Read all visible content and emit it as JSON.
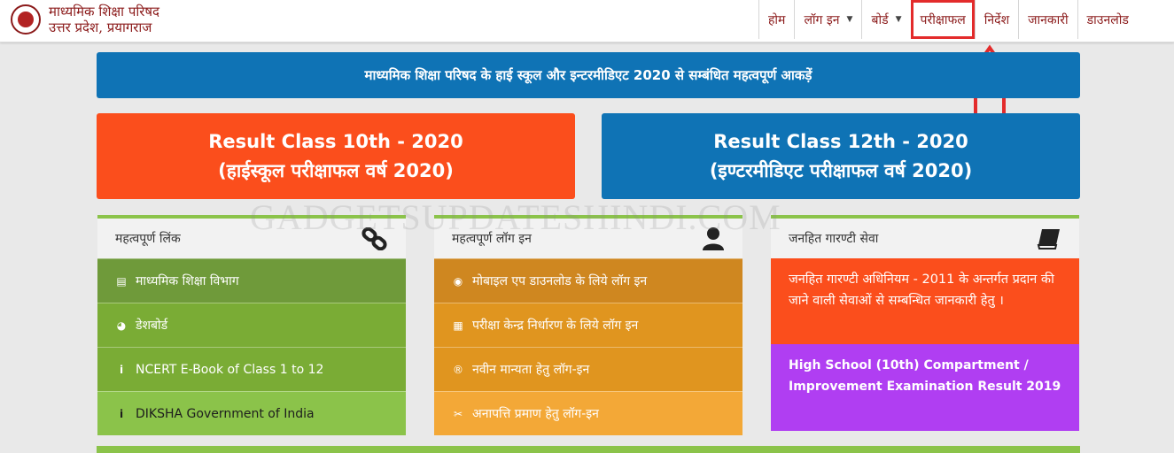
{
  "header": {
    "brand_line1": "माध्यमिक शिक्षा परिषद",
    "brand_line2": "उत्तर प्रदेश, प्रयागराज",
    "nav": [
      {
        "label": "होम"
      },
      {
        "label": "लॉग इन"
      },
      {
        "label": "बोर्ड"
      },
      {
        "label": "परीक्षाफल"
      },
      {
        "label": "निर्देश"
      },
      {
        "label": "जानकारी"
      },
      {
        "label": "डाउनलोड"
      }
    ]
  },
  "banner": {
    "text": "माध्यमिक शिक्षा परिषद के हाई स्कूल और इन्टरमीडिएट 2020 से सम्बंधित महत्वपूर्ण आकड़ें"
  },
  "results": {
    "class10": {
      "line1": "Result Class 10th - 2020",
      "line2": "(हाईस्कूल परीक्षाफल वर्ष 2020)"
    },
    "class12": {
      "line1": "Result Class 12th - 2020",
      "line2": "(इण्टरमीडिएट परीक्षाफल वर्ष 2020)"
    }
  },
  "panels": {
    "links": {
      "title": "महत्वपूर्ण लिंक",
      "items": [
        {
          "label": "माध्यमिक शिक्षा विभाग"
        },
        {
          "label": "डेशबोर्ड"
        },
        {
          "label": "NCERT E-Book of Class 1 to 12"
        },
        {
          "label": "DIKSHA Government of India"
        }
      ]
    },
    "logins": {
      "title": "महत्वपूर्ण लॉग इन",
      "items": [
        {
          "label": "मोबाइल एप डाउनलोड के लिये लॉग इन"
        },
        {
          "label": "परीक्षा केन्द्र निर्धारण के लिये लॉग इन"
        },
        {
          "label": "नवीन मान्यता हेतु लॉग-इन"
        },
        {
          "label": "अनापत्ति प्रमाण हेतु लॉग-इन"
        }
      ]
    },
    "service": {
      "title": "जनहित गारण्टी सेवा",
      "info_text": "जनहित गारण्टी अधिनियम - 2011 के अन्तर्गत प्रदान की जाने वाली सेवाओं से सम्बन्धित जानकारी हेतु ।",
      "result_link": "High School (10th) Compartment / Improvement Examination Result 2019"
    }
  },
  "watermark": "GADGETSUPDATESHINDI.COM",
  "colors": {
    "brand": "#8b1a1a",
    "blue": "#0f73b5",
    "orange_red": "#fb4e1c",
    "green": "#8bc34a",
    "purple": "#b03ef2",
    "annotation": "#e32b2b"
  }
}
